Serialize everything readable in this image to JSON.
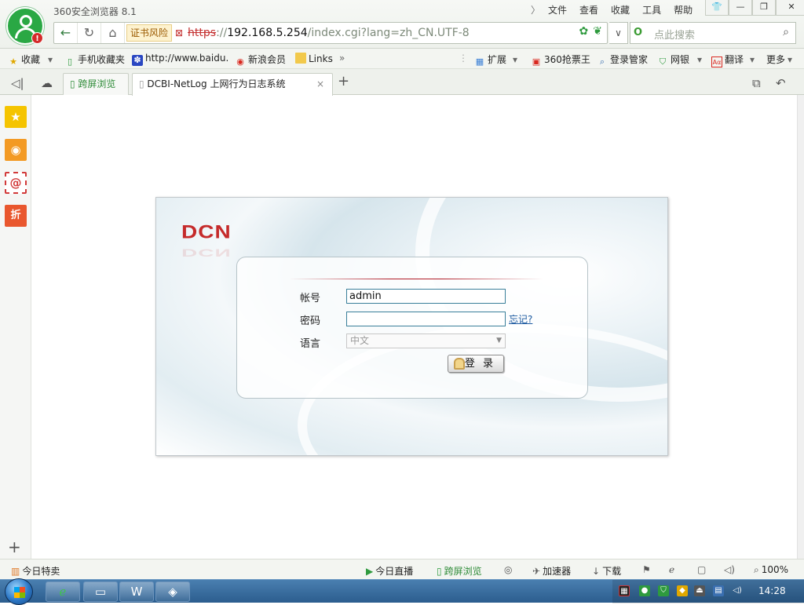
{
  "app": {
    "title": "360安全浏览器 8.1"
  },
  "menu": {
    "chevron": "〉",
    "items": [
      "文件",
      "查看",
      "收藏",
      "工具",
      "帮助"
    ]
  },
  "window_buttons": {
    "shirt": "👕",
    "minimize": "—",
    "restore": "❐",
    "close": "✕"
  },
  "address": {
    "back": "←",
    "refresh": "↻",
    "home": "⌂",
    "cert_warning": "证书风险",
    "url_scheme": "https",
    "url_sep": "://",
    "url_host": "192.168.5.254",
    "url_rest": "/index.cgi?lang=zh_CN.UTF-8",
    "dropdown": "∨"
  },
  "search": {
    "placeholder": "点此搜索",
    "engine_icon": "O"
  },
  "bookmarks": {
    "left": [
      {
        "icon": "star-add-icon",
        "label": "收藏"
      },
      {
        "icon": "phone-icon",
        "label": "手机收藏夹"
      },
      {
        "icon": "baidu-paw-icon",
        "label": "http://www.baidu."
      },
      {
        "icon": "weibo-icon",
        "label": "新浪会员"
      },
      {
        "icon": "folder-icon",
        "label": "Links"
      }
    ],
    "overflow": "»",
    "right": [
      {
        "icon": "extension-icon",
        "label": "扩展"
      },
      {
        "icon": "ticket-icon",
        "label": "360抢票王"
      },
      {
        "icon": "search-user-icon",
        "label": "登录管家"
      },
      {
        "icon": "shield-yen-icon",
        "label": "网银"
      },
      {
        "icon": "translate-icon",
        "label": "翻译"
      },
      {
        "icon": "more-icon",
        "label": "更多"
      }
    ]
  },
  "tabs": {
    "split_view": "跨屏浏览",
    "active": {
      "title": "DCBI-NetLog 上网行为日志系统",
      "close": "×"
    },
    "new_tab": "+"
  },
  "sidebar": {
    "star": "★",
    "weibo": "◉",
    "mail": "@",
    "zhe": "折",
    "add": "+"
  },
  "login": {
    "brand": "DCN",
    "account_label": "帐号",
    "account_value": "admin",
    "password_label": "密码",
    "password_value": "",
    "forgot": "忘记?",
    "language_label": "语言",
    "language_value": "中文",
    "submit": "登 录"
  },
  "status": {
    "daily_deals": "今日特卖",
    "live": "今日直播",
    "split_view": "跨屏浏览",
    "accelerator": "加速器",
    "download": "下载",
    "zoom": "100%"
  },
  "taskbar": {
    "clock": "14:28"
  },
  "colors": {
    "accent_green": "#2aa844",
    "brand_red": "#c52a2a",
    "link_blue": "#1c5aa0"
  }
}
